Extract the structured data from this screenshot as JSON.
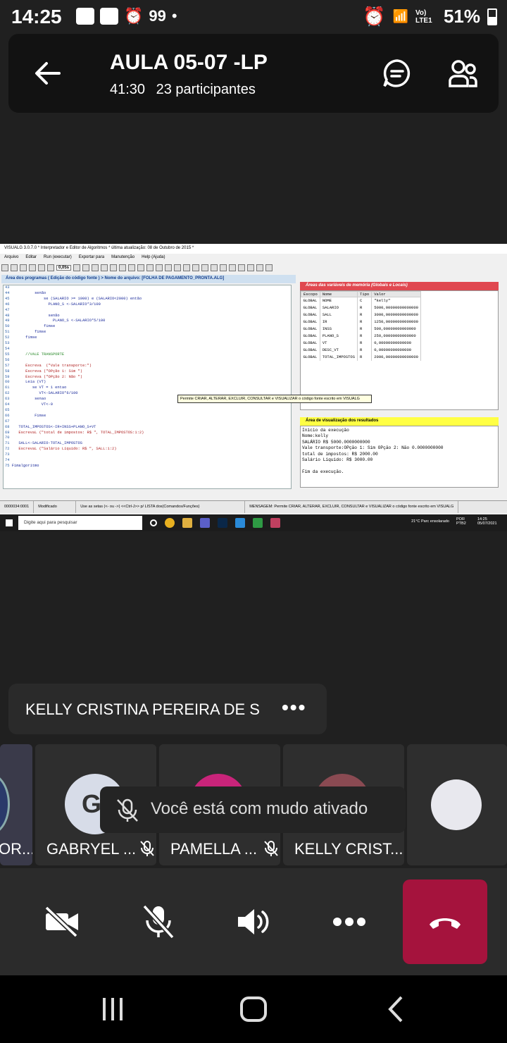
{
  "status_bar": {
    "time": "14:25",
    "notif_count": "99",
    "dot": "•",
    "network": "Vo) LTE1",
    "battery_pct": "51%"
  },
  "call": {
    "title": "AULA 05-07 -LP",
    "duration": "41:30",
    "participants": "23 participantes",
    "presenter_name": "KELLY CRISTINA PEREIRA DE S",
    "more_label": "•••"
  },
  "shared_screen": {
    "window_title": "VISUALG 3.0.7.0 * Interpretador e Editor de Algoritmos * última atualização: 08 de Outubro de 2015 *",
    "menu": [
      "Arquivo",
      "Editar",
      "Run (executar)",
      "Exportar para",
      "Manutenção",
      "Help (Ajuda)"
    ],
    "zoom": "0,05s",
    "code_header": "Área dos programas ( Edição do código fonte ) > Nome do arquivo: [FOLHA DE PAGAMENTO_PRONTA.ALG]",
    "code_lines": [
      {
        "n": "43",
        "t": ""
      },
      {
        "n": "44",
        "t": "          senão"
      },
      {
        "n": "45",
        "t": "              se (SALARIO >= 1000) e (SALARIO<2000) então"
      },
      {
        "n": "46",
        "t": "                PLANO_S <-SALARIO*3/100"
      },
      {
        "n": "47",
        "t": ""
      },
      {
        "n": "48",
        "t": "                senão"
      },
      {
        "n": "49",
        "t": "                  PLANO_S <-SALARIO*5/100"
      },
      {
        "n": "50",
        "t": "              fimse"
      },
      {
        "n": "51",
        "t": "          fimse"
      },
      {
        "n": "52",
        "t": "      fimse"
      },
      {
        "n": "53",
        "t": ""
      },
      {
        "n": "54",
        "t": ""
      },
      {
        "n": "55",
        "t": "      //VALE TRANSPORTE"
      },
      {
        "n": "56",
        "t": ""
      },
      {
        "n": "57",
        "t": "      Escreva  (\"Vale transporte:\")"
      },
      {
        "n": "58",
        "t": "      Escreva (\"OPção 1: Sim \")"
      },
      {
        "n": "59",
        "t": "      Escreva (\"OPção 2: Não \")"
      },
      {
        "n": "60",
        "t": "      Leia (VT)"
      },
      {
        "n": "61",
        "t": "         se VT = 1 entao"
      },
      {
        "n": "62",
        "t": "            VT<-SALARIO*6/100"
      },
      {
        "n": "63",
        "t": "          senao"
      },
      {
        "n": "64",
        "t": "             VT<-0"
      },
      {
        "n": "65",
        "t": ""
      },
      {
        "n": "66",
        "t": "          Fimse"
      },
      {
        "n": "67",
        "t": ""
      },
      {
        "n": "68",
        "t": "   TOTAL_IMPOSTOS<-IR+INSS+PLANO_S+VT"
      },
      {
        "n": "69",
        "t": "   EscrevaL (\"total de impostos: R$ \", TOTAL_IMPOSTOS:1:2)"
      },
      {
        "n": "70",
        "t": ""
      },
      {
        "n": "71",
        "t": "   SALL<-SALARIO-TOTAL_IMPOSTOS"
      },
      {
        "n": "72",
        "t": "   EscrevaL (\"Salário Líquido: R$ \", SALL:1:2)"
      },
      {
        "n": "73",
        "t": ""
      },
      {
        "n": "74",
        "t": ""
      },
      {
        "n": "75",
        "t": "Fimalgoritmo"
      }
    ],
    "vars_header": "Áreas das variáveis de memória (Globais e Locais)",
    "vars_columns": [
      "Escopo",
      "Nome",
      "Tipo",
      "Valor"
    ],
    "vars_rows": [
      [
        "GLOBAL",
        "NOME",
        "C",
        "\"kelly\""
      ],
      [
        "GLOBAL",
        "SALARIO",
        "R",
        "5000,00000000000000"
      ],
      [
        "GLOBAL",
        "SALL",
        "R",
        "3000,00000000000000"
      ],
      [
        "GLOBAL",
        "IR",
        "R",
        "1250,00000000000000"
      ],
      [
        "GLOBAL",
        "INSS",
        "R",
        "500,00000000000000"
      ],
      [
        "GLOBAL",
        "PLANO_S",
        "R",
        "250,00000000000000"
      ],
      [
        "GLOBAL",
        "VT",
        "R",
        "0,00000000000000"
      ],
      [
        "GLOBAL",
        "DESC_VT",
        "R",
        "0,00000000000000"
      ],
      [
        "GLOBAL",
        "TOTAL_IMPOSTOS",
        "R",
        "2000,00000000000000"
      ]
    ],
    "tooltip": "Permite CRIAR, ALTERAR, EXCLUIR, CONSULTAR e VISUALIZAR o código fonte escrito em VISUALG",
    "results_header": "Área de visualização dos resultados",
    "results_lines": [
      "Início da execução",
      "Nome:kelly",
      "SALÁRIO R$ 5000.0000000000",
      "Vale transporte:OPção 1: Sim OPção 2: Não 0.0000000000",
      "total de impostos: R$ 2000.00",
      "Salário Líquido: R$ 3000.00",
      "",
      "Fim da execução."
    ],
    "status": [
      "0000034:0001",
      "Modificado",
      "Use as setas (<- ou ->) <<Ctrl-J>> p/ LISTA dos(Comandos/Funções)",
      "MENSAGEM: Permite CRIAR, ALTERAR, EXCLUIR, CONSULTAR e VISUALIZAR o código fonte escrito em VISUALG"
    ],
    "taskbar_search": "Digite aqui para pesquisar",
    "weather": "21°C  Parc ensolarado",
    "lang": "POR PTB2",
    "clock": "14:25 05/07/2021"
  },
  "tiles": [
    {
      "label": "OR..."
    },
    {
      "label": "GABRYEL ...",
      "initials": "GI"
    },
    {
      "label": "PAMELLA ..."
    },
    {
      "label": "KELLY CRIST..."
    }
  ],
  "toast": "Você está com mudo ativado",
  "colors": {
    "end_call": "#a5133d",
    "background": "#202020"
  }
}
